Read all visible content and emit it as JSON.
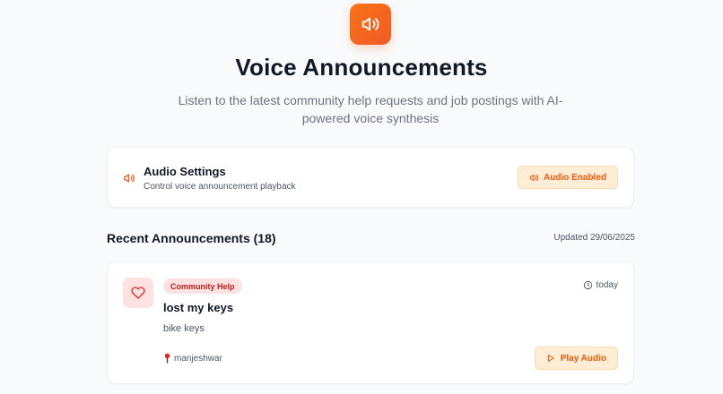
{
  "header": {
    "icon": "speaker-icon",
    "title": "Voice Announcements",
    "subtitle": "Listen to the latest community help requests and job postings with AI-powered voice synthesis"
  },
  "settings": {
    "icon": "speaker-icon",
    "title": "Audio Settings",
    "description": "Control voice announcement playback",
    "button_label": "Audio Enabled"
  },
  "announcements": {
    "heading": "Recent Announcements (18)",
    "updated": "Updated 29/06/2025",
    "items": [
      {
        "icon": "heart-icon",
        "category": "Community Help",
        "time": "today",
        "title": "lost my keys",
        "description": "bike keys",
        "location": "manjeshwar",
        "play_label": "Play Audio"
      }
    ]
  },
  "colors": {
    "accent": "#f97316",
    "accent_text": "#ea580c",
    "accent_bg": "#ffedd5",
    "community_tag_bg": "#fee2e2",
    "community_tag_text": "#b91c1c"
  }
}
